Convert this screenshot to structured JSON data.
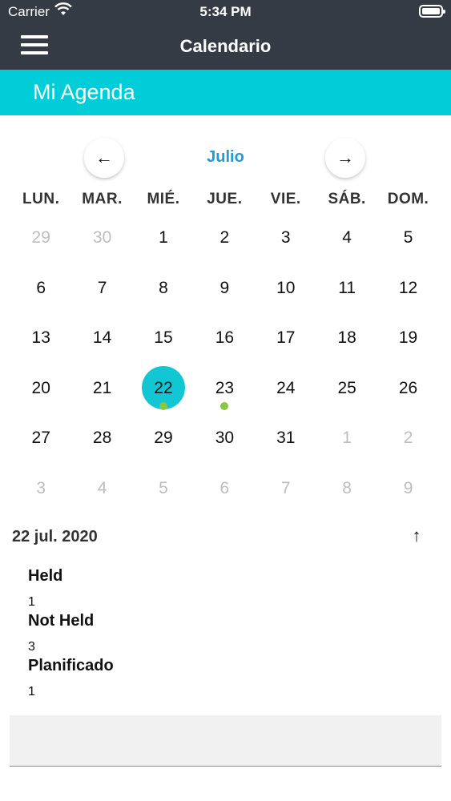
{
  "status_bar": {
    "carrier": "Carrier",
    "time": "5:34 PM"
  },
  "nav": {
    "title": "Calendario",
    "menu_icon": "hamburger-icon"
  },
  "agenda": {
    "title": "Mi Agenda"
  },
  "calendar": {
    "month": "Julio",
    "prev_icon": "arrow-left-icon",
    "next_icon": "arrow-right-icon",
    "weekdays": [
      "LUN.",
      "MAR.",
      "MIÉ.",
      "JUE.",
      "VIE.",
      "SÁB.",
      "DOM."
    ],
    "weeks": [
      [
        {
          "d": "29",
          "other": true
        },
        {
          "d": "30",
          "other": true
        },
        {
          "d": "1"
        },
        {
          "d": "2"
        },
        {
          "d": "3"
        },
        {
          "d": "4"
        },
        {
          "d": "5"
        }
      ],
      [
        {
          "d": "6"
        },
        {
          "d": "7"
        },
        {
          "d": "8"
        },
        {
          "d": "9"
        },
        {
          "d": "10"
        },
        {
          "d": "11"
        },
        {
          "d": "12"
        }
      ],
      [
        {
          "d": "13"
        },
        {
          "d": "14"
        },
        {
          "d": "15"
        },
        {
          "d": "16"
        },
        {
          "d": "17"
        },
        {
          "d": "18"
        },
        {
          "d": "19"
        }
      ],
      [
        {
          "d": "20"
        },
        {
          "d": "21"
        },
        {
          "d": "22",
          "selected": true,
          "dot": true
        },
        {
          "d": "23",
          "dot": true
        },
        {
          "d": "24"
        },
        {
          "d": "25"
        },
        {
          "d": "26"
        }
      ],
      [
        {
          "d": "27"
        },
        {
          "d": "28"
        },
        {
          "d": "29"
        },
        {
          "d": "30"
        },
        {
          "d": "31"
        },
        {
          "d": "1",
          "other": true
        },
        {
          "d": "2",
          "other": true
        }
      ],
      [
        {
          "d": "3",
          "other": true
        },
        {
          "d": "4",
          "other": true
        },
        {
          "d": "5",
          "other": true
        },
        {
          "d": "6",
          "other": true
        },
        {
          "d": "7",
          "other": true
        },
        {
          "d": "8",
          "other": true
        },
        {
          "d": "9",
          "other": true
        }
      ]
    ]
  },
  "selected": {
    "date": "22 jul. 2020",
    "collapse_icon": "arrow-up-icon",
    "stats": [
      {
        "label": "Held",
        "value": "1"
      },
      {
        "label": "Not Held",
        "value": "3"
      },
      {
        "label": "Planificado",
        "value": "1"
      }
    ]
  },
  "colors": {
    "nav_bg": "#353b45",
    "accent": "#00cdd8",
    "selected_day": "#13c6d3",
    "event_dot": "#8cc63f",
    "month_label": "#1e9bd8"
  }
}
